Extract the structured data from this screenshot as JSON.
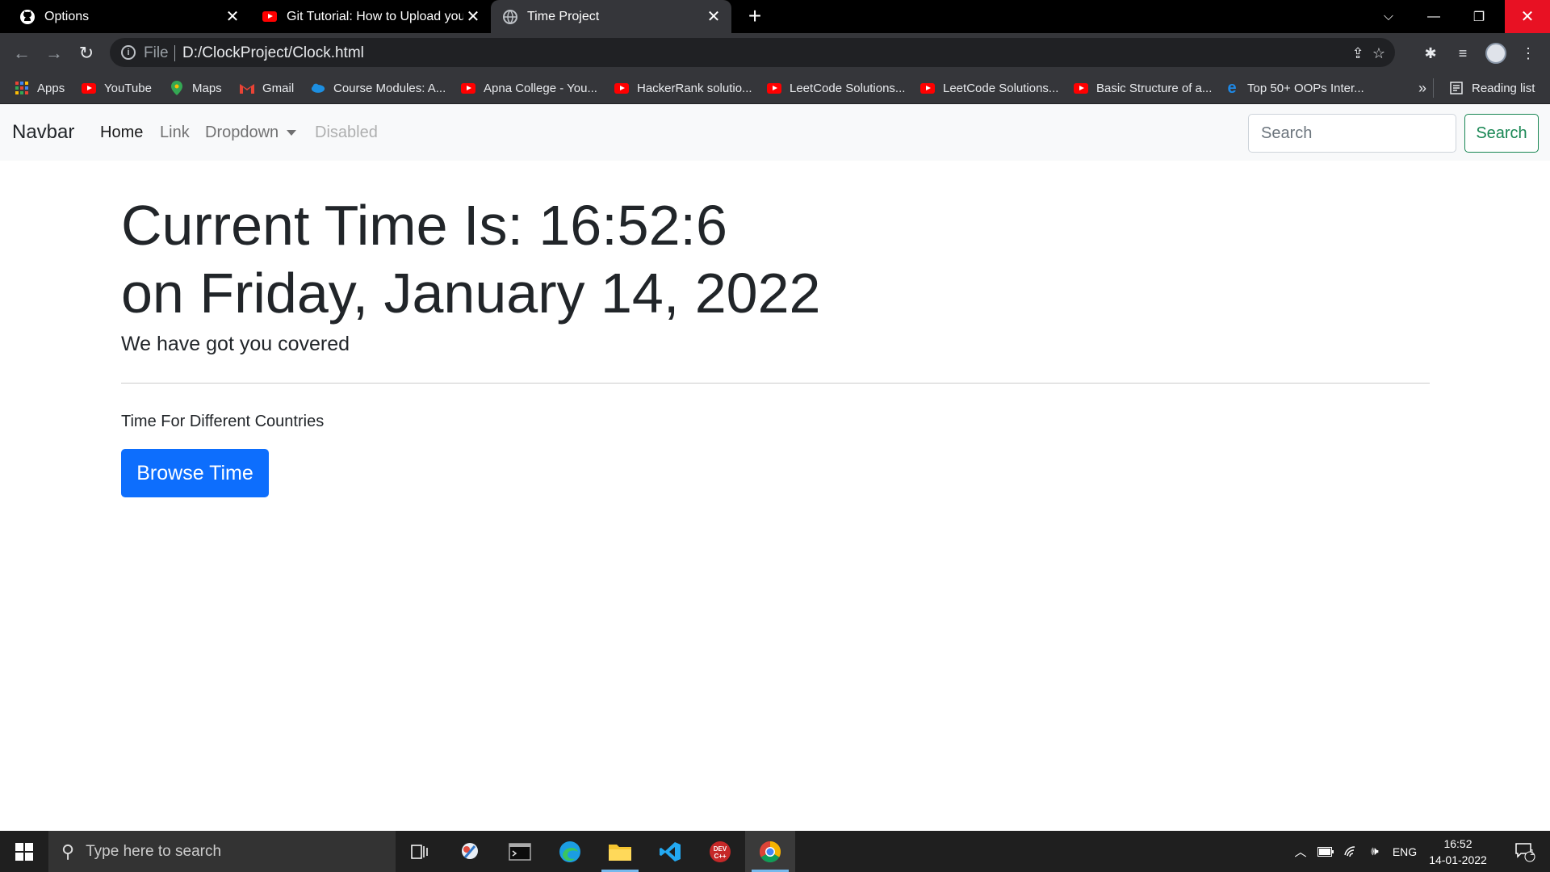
{
  "browser": {
    "tabs": [
      {
        "title": "Options",
        "favicon": "github-icon"
      },
      {
        "title": "Git Tutorial: How to Upload your",
        "favicon": "youtube-icon"
      },
      {
        "title": "Time Project",
        "favicon": "globe-icon"
      }
    ],
    "address": {
      "scheme_label": "File",
      "url": "D:/ClockProject/Clock.html"
    },
    "bookmarks": [
      {
        "label": "Apps",
        "icon": "apps-grid-icon"
      },
      {
        "label": "YouTube",
        "icon": "youtube-icon"
      },
      {
        "label": "Maps",
        "icon": "maps-icon"
      },
      {
        "label": "Gmail",
        "icon": "gmail-icon"
      },
      {
        "label": "Course Modules: A...",
        "icon": "cloud-icon"
      },
      {
        "label": "Apna College - You...",
        "icon": "youtube-icon"
      },
      {
        "label": "HackerRank solutio...",
        "icon": "youtube-icon"
      },
      {
        "label": "LeetCode Solutions...",
        "icon": "youtube-icon"
      },
      {
        "label": "LeetCode Solutions...",
        "icon": "youtube-icon"
      },
      {
        "label": "Basic Structure of a...",
        "icon": "youtube-icon"
      },
      {
        "label": "Top 50+ OOPs Inter...",
        "icon": "e-logo-icon"
      }
    ],
    "bookmarks_overflow": "»",
    "reading_list": "Reading list"
  },
  "navbar": {
    "brand": "Navbar",
    "links": {
      "home": "Home",
      "link": "Link",
      "dropdown": "Dropdown",
      "disabled": "Disabled"
    },
    "search_placeholder": "Search",
    "search_button": "Search"
  },
  "main": {
    "time_line": "Current Time Is: 16:52:6",
    "date_line": "on Friday, January 14, 2022",
    "lead": "We have got you covered",
    "subheading": "Time For Different Countries",
    "browse_button": "Browse Time"
  },
  "taskbar": {
    "search_placeholder": "Type here to search",
    "language": "ENG",
    "time": "16:52",
    "date": "14-01-2022",
    "notification_count": "1"
  },
  "colors": {
    "primary": "#0d6efd",
    "success": "#198754",
    "chrome_dark": "#35363a"
  }
}
